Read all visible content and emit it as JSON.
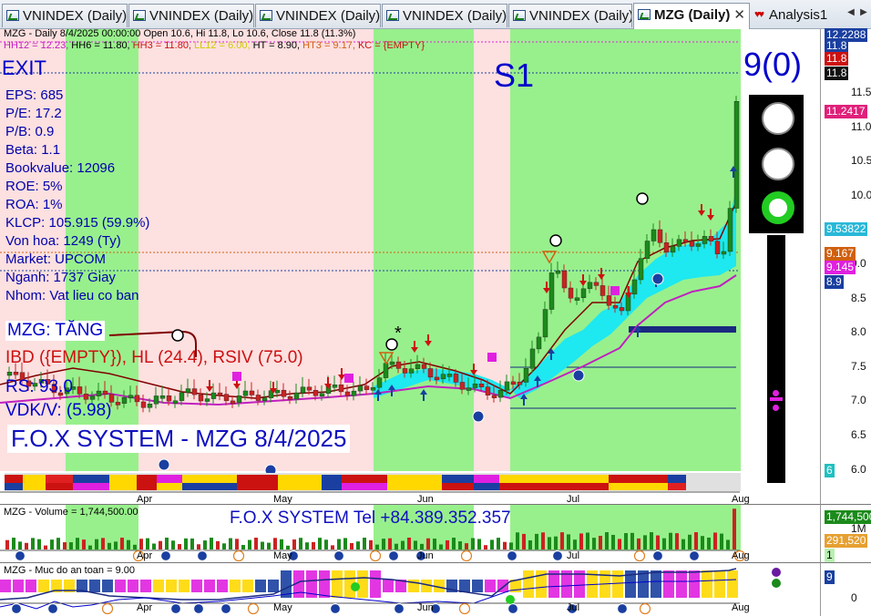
{
  "tabs": [
    {
      "label": "VNINDEX (Daily)",
      "active": false
    },
    {
      "label": "VNINDEX (Daily)",
      "active": false
    },
    {
      "label": "VNINDEX (Daily)",
      "active": false
    },
    {
      "label": "VNINDEX (Daily)",
      "active": false
    },
    {
      "label": "VNINDEX (Daily)",
      "active": false
    },
    {
      "label": "MZG (Daily)",
      "active": true,
      "close": "✕"
    },
    {
      "label": "Analysis1",
      "active": false
    }
  ],
  "nav": {
    "left": "◀",
    "right": "▶"
  },
  "info": {
    "line1": "MZG - Daily 8/4/2025 00:00:00 Open 10.6, Hi 11.8, Lo 10.6, Close 11.8 (11.3%)",
    "hh12": "HH12 = 12.23,",
    "hh6": " HH6 = 11.80,",
    "hh3": " HH3 = 11.80,",
    "ll12": " LL12 = 6.00,",
    "ht": " HT  = 8.90,",
    "ht3": " HT3  = 9.17,",
    "kc": " KC = {EMPTY}"
  },
  "signals": {
    "exit": "EXIT",
    "s1": "S1",
    "count": "9(0)"
  },
  "fundamentals": [
    "EPS: 685",
    "P/E: 17.2",
    "P/B: 0.9",
    "Beta: 1.1",
    "Bookvalue: 12096",
    "ROE: 5%",
    "ROA: 1%",
    "KLCP: 105.915 (59.9%)",
    "Von hoa: 1249 (Ty)",
    "Market: UPCOM",
    "Nganh: 1737 Giay",
    "Nhom: Vat lieu co ban"
  ],
  "status": {
    "trend": "MZG: TĂNG",
    "ibd": "IBD ({EMPTY}), HL (24.4), RSIV (75.0)",
    "rs": "RS: 93.0",
    "vdkv": "VDK/V:  (5.98)",
    "brand": "F.O.X SYSTEM - MZG 8/4/2025"
  },
  "price_axis": {
    "ticks": [
      "11.5",
      "11.0",
      "10.5",
      "10.0",
      "9.5",
      "9.0",
      "8.5",
      "8.0",
      "7.5",
      "7.0",
      "6.5",
      "6.0"
    ],
    "labels": [
      {
        "text": "12.2288",
        "color": "#1a3fa0"
      },
      {
        "text": "11.8",
        "color": "#1a3fa0"
      },
      {
        "text": "11.8",
        "color": "#cc1111"
      },
      {
        "text": "11.8",
        "color": "#111111"
      },
      {
        "text": "11.2417",
        "color": "#e0207a"
      },
      {
        "text": "9.53822",
        "color": "#2ab8d8"
      },
      {
        "text": "9.167",
        "color": "#d06010"
      },
      {
        "text": "9.145",
        "color": "#e020e0"
      },
      {
        "text": "8.9",
        "color": "#1a3fa0"
      },
      {
        "text": "6",
        "color": "#20c0c0"
      }
    ]
  },
  "months": [
    "Apr",
    "May",
    "Jun",
    "Jul",
    "Aug"
  ],
  "volume": {
    "title": "MZG - Volume = 1,744,500.00",
    "tel": "F.O.X SYSTEM Tel +84.389.352.357",
    "axis": {
      "vol_label": "1,744,500",
      "tick": "1M",
      "ma_label": "291,520",
      "small": "1"
    }
  },
  "safety": {
    "title": "MZG - Muc do an toan = 9.00",
    "axis": {
      "label": "9",
      "tick": "0"
    }
  },
  "colors": {
    "green_zone": "#98f08c",
    "pink_zone": "#fde0e0",
    "up_candle": "#1b8a1b",
    "down_candle": "#cc2222",
    "title_blue": "#1010c0"
  }
}
